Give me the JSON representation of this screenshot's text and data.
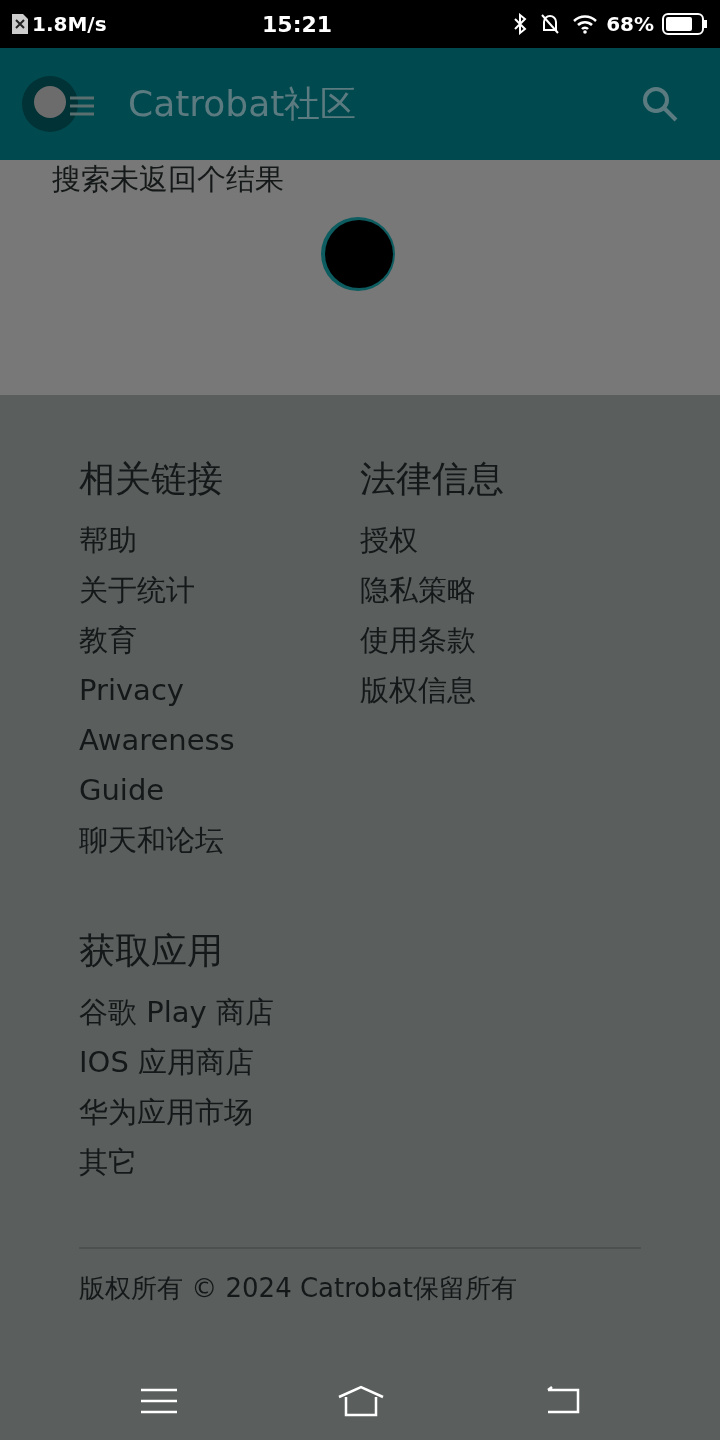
{
  "status_bar": {
    "speed": "1.8M/s",
    "time": "15:21",
    "battery": "68%"
  },
  "app_bar": {
    "title": "Catrobat社区"
  },
  "search_result": {
    "message": "搜索未返回个结果"
  },
  "footer": {
    "columns": [
      {
        "heading": "相关链接",
        "links": [
          "帮助",
          "关于统计",
          "教育",
          "Privacy",
          "Awareness",
          "Guide",
          "聊天和论坛"
        ]
      },
      {
        "heading": "法律信息",
        "links": [
          "授权",
          "隐私策略",
          "使用条款",
          "版权信息"
        ]
      }
    ],
    "apps": {
      "heading": "获取应用",
      "links": [
        "谷歌 Play 商店",
        "IOS 应用商店",
        "华为应用市场",
        "其它"
      ]
    },
    "copyright": "版权所有 © 2024 Catrobat保留所有"
  }
}
